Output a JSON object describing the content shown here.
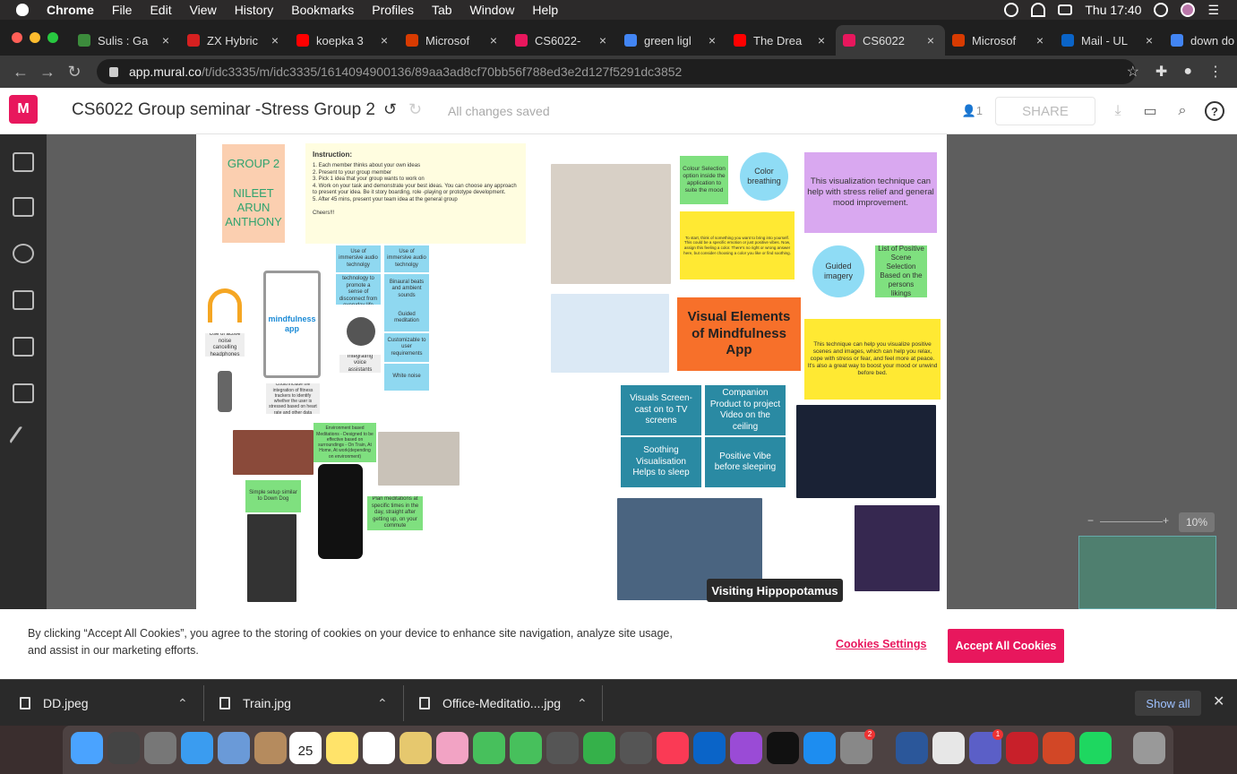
{
  "menubar": {
    "app": "Chrome",
    "items": [
      "File",
      "Edit",
      "View",
      "History",
      "Bookmarks",
      "Profiles",
      "Tab",
      "Window",
      "Help"
    ],
    "clock": "Thu 17:40"
  },
  "tabs": [
    {
      "title": "Sulis : Ga",
      "color": "#3c8c3c"
    },
    {
      "title": "ZX Hybric",
      "color": "#d62020"
    },
    {
      "title": "koepka 3",
      "color": "#ff0000"
    },
    {
      "title": "Microsof",
      "color": "#d83b01"
    },
    {
      "title": "CS6022-",
      "color": "#e8175d"
    },
    {
      "title": "green ligl",
      "color": "#4285f4"
    },
    {
      "title": "The Drea",
      "color": "#ff0000"
    },
    {
      "title": "CS6022",
      "color": "#e8175d",
      "active": true
    },
    {
      "title": "Microsof",
      "color": "#d83b01"
    },
    {
      "title": "Mail - UL",
      "color": "#0a64c8"
    },
    {
      "title": "down do",
      "color": "#4285f4"
    }
  ],
  "address": {
    "host": "app.mural.co",
    "path": "/t/idc3335/m/idc3335/1614094900136/89aa3ad8cf70bb56f788ed3e2d127f5291dc3852"
  },
  "mural": {
    "logo": "M",
    "title": "CS6022 Group seminar -Stress Group 2",
    "saved": "All changes saved",
    "users": "1",
    "share": "SHARE",
    "help": "?"
  },
  "board": {
    "group": "GROUP 2\n\nNILEET\nARUN\nANTHONY",
    "instruction_title": "Instruction:",
    "instruction_body": "1. Each member thinks about your own ideas\n2. Present to your group member\n3. Pick 1 idea that your group wants to work on\n4. Work on your task and demonstrate your best ideas. You can choose any approach to present your idea. Be it story boarding, role -playing or prototype development.\n5. After 45 mins, present your team idea at the general group\n\nCheers!!!",
    "mindfulness": "mindfulness app",
    "n1": "Use of immersive audio technolgy",
    "n2": "Use of immersive audio technolgy",
    "n3": "Minimal use of technology to promote a sense of disconnect from everyday life",
    "n4": "Binaural beats and ambient sounds",
    "n5": "Guided meditation",
    "n6": "Customizable to user requirements",
    "n7": "White noise",
    "n8": "Use of active noise cancelling headphones",
    "n9": "Integrating voice assistants",
    "n10": "Could include the integration of fitness trackers to identify whether the user is stressed based on heart rate and other data",
    "n11": "Environment based Meditations - Designed to be effective based on surroundings - On Train, At Home, At work(depending on environment)",
    "n12": "Simple setup similar to Down Dog",
    "n13": "Plan meditations at specific times in the day, straight after getting up, on your commute",
    "c1": "Colour Selection option inside the application to suite the mood",
    "c2": "Color breathing",
    "c3": "This visualization technique can help with stress relief and general mood improvement.",
    "c4": "To start, think of something you want to bring into yourself. This could be a specific emotion or just positive vibes. Now, assign this feeling a color. There's no right or wrong answer here, but consider choosing a color you like or find soothing.",
    "c5": "Guided imagery",
    "c6": "List of Positive Scene Selection Based on the persons likings",
    "c7": "Visual Elements of Mindfulness App",
    "c8": "This technique can help you visualize positive scenes and images, which can help you relax, cope with stress or fear, and feel more at peace. It's also a great way to boost your mood or unwind before bed.",
    "t1": "Visuals Screen-cast on to TV screens",
    "t2": "Companion Product to project Video on the ceiling",
    "t3": "Soothing Visualisation Helps to sleep",
    "t4": "Positive Vibe before sleeping"
  },
  "tooltip": "Visiting Hippopotamus",
  "zoom": "10%",
  "cookie": {
    "text": "By clicking “Accept All Cookies”, you agree to the storing of cookies on your device to enhance site navigation, analyze site usage, and assist in our marketing efforts.",
    "settings": "Cookies Settings",
    "accept": "Accept All Cookies"
  },
  "downloads": {
    "files": [
      "DD.jpeg",
      "Train.jpg",
      "Office-Meditatio....jpg"
    ],
    "show_all": "Show all"
  },
  "dock": {
    "calendar_day": "25",
    "badge_settings": "2",
    "badge_teams": "1"
  },
  "colors": {
    "brand": "#e8175d",
    "teal": "#2a8aa3",
    "sticky_yellow": "#ffe933",
    "sticky_green": "#7fe07f",
    "orange": "#f7702a",
    "purple": "#d9a8f0",
    "cyan": "#8fd8f0"
  }
}
